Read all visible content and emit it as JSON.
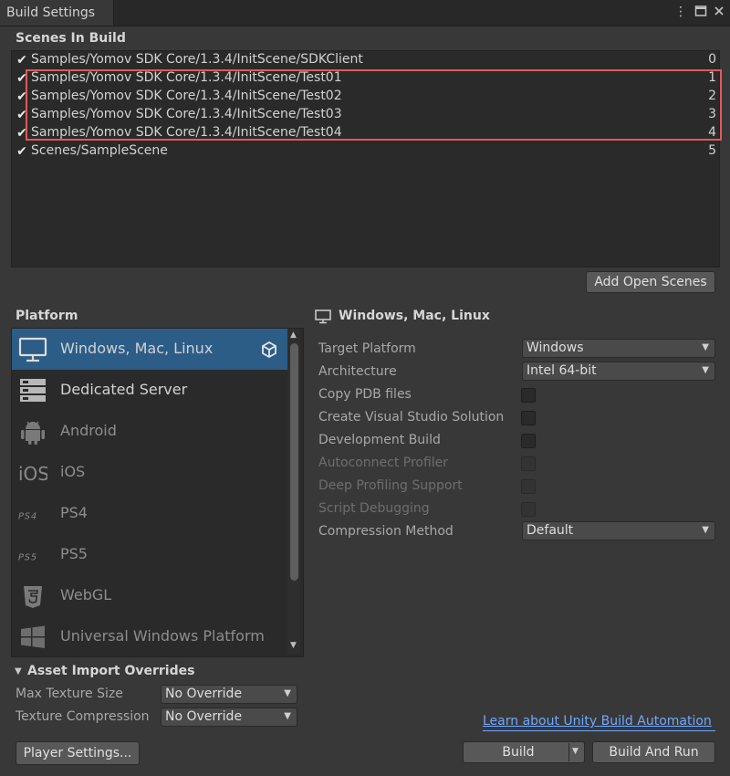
{
  "window": {
    "tab_title": "Build Settings"
  },
  "scenes": {
    "title": "Scenes In Build",
    "items": [
      {
        "path": "Samples/Yomov SDK Core/1.3.4/InitScene/SDKClient",
        "index": "0"
      },
      {
        "path": "Samples/Yomov SDK Core/1.3.4/InitScene/Test01",
        "index": "1"
      },
      {
        "path": "Samples/Yomov SDK Core/1.3.4/InitScene/Test02",
        "index": "2"
      },
      {
        "path": "Samples/Yomov SDK Core/1.3.4/InitScene/Test03",
        "index": "3"
      },
      {
        "path": "Samples/Yomov SDK Core/1.3.4/InitScene/Test04",
        "index": "4"
      },
      {
        "path": "Scenes/SampleScene",
        "index": "5"
      }
    ],
    "add_open_scenes": "Add Open Scenes"
  },
  "platform": {
    "title": "Platform",
    "items": [
      {
        "label": "Windows, Mac, Linux",
        "icon": "monitor-icon"
      },
      {
        "label": "Dedicated Server",
        "icon": "server-icon"
      },
      {
        "label": "Android",
        "icon": "android-icon"
      },
      {
        "label": "iOS",
        "icon": "ios-icon"
      },
      {
        "label": "PS4",
        "icon": "ps4-icon"
      },
      {
        "label": "PS5",
        "icon": "ps5-icon"
      },
      {
        "label": "WebGL",
        "icon": "html5-icon"
      },
      {
        "label": "Universal Windows Platform",
        "icon": "windows-logo-icon"
      }
    ]
  },
  "settings": {
    "header": "Windows, Mac, Linux",
    "target_platform": {
      "label": "Target Platform",
      "value": "Windows"
    },
    "architecture": {
      "label": "Architecture",
      "value": "Intel 64-bit"
    },
    "copy_pdb": {
      "label": "Copy PDB files"
    },
    "create_vs": {
      "label": "Create Visual Studio Solution"
    },
    "dev_build": {
      "label": "Development Build"
    },
    "autoconnect": {
      "label": "Autoconnect Profiler"
    },
    "deep_profiling": {
      "label": "Deep Profiling Support"
    },
    "script_debugging": {
      "label": "Script Debugging"
    },
    "compression": {
      "label": "Compression Method",
      "value": "Default"
    }
  },
  "asset_overrides": {
    "title": "Asset Import Overrides",
    "max_texture": {
      "label": "Max Texture Size",
      "value": "No Override"
    },
    "texture_compression": {
      "label": "Texture Compression",
      "value": "No Override"
    }
  },
  "footer": {
    "learn_link": "Learn about Unity Build Automation",
    "player_settings": "Player Settings...",
    "build": "Build",
    "build_and_run": "Build And Run"
  },
  "colors": {
    "selection": "#2c5d87",
    "highlight_border": "#e05a5a",
    "link": "#6fa8ff"
  }
}
